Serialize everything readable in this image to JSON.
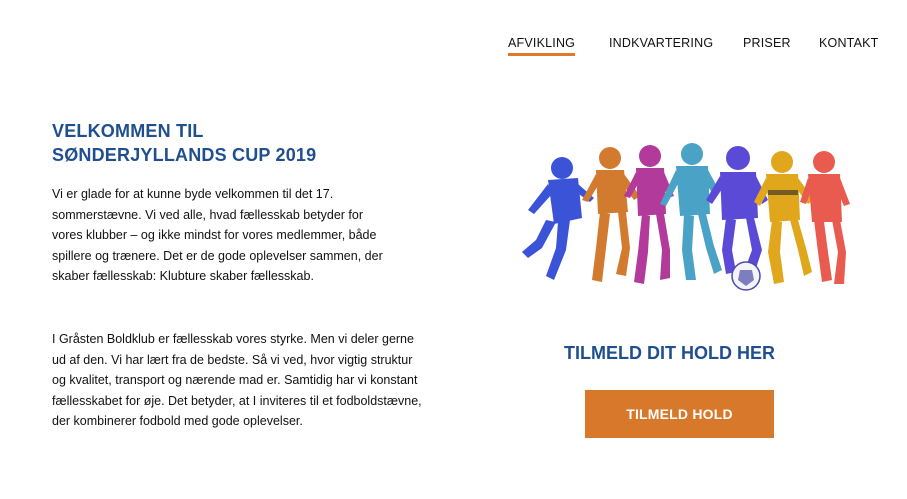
{
  "nav": {
    "items": [
      {
        "label": "AFVIKLING",
        "active": true
      },
      {
        "label": "INDKVARTERING",
        "active": false
      },
      {
        "label": "PRISER",
        "active": false
      },
      {
        "label": "KONTAKT",
        "active": false
      }
    ],
    "accent_color": "#e07a2a"
  },
  "main": {
    "title_line1": "VELKOMMEN TIL",
    "title_line2": "SØNDERJYLLANDS CUP 2019",
    "paragraph1": "Vi er glade for at kunne byde velkommen til det 17. sommerstævne. Vi ved alle, hvad fællesskab betyder for vores klubber – og ikke mindst for vores medlemmer, både spillere og trænere. Det er de gode oplevelser sammen, der skaber fællesskab: Klubture skaber fællesskab.",
    "paragraph2": "I Gråsten Boldklub er fællesskab vores styrke. Men vi deler gerne ud af den. Vi har lært fra de bedste. Så vi ved, hvor vigtig struktur og kvalitet, transport og nærende mad er. Samtidig har vi konstant fællesskabet for øje. Det betyder, at I inviteres til et fodboldstævne, der kombinerer fodbold med gode oplevelser."
  },
  "hero": {
    "image": "children-playing-football-illustration",
    "player_colors": [
      "#3b53d6",
      "#d27a2e",
      "#b23a9b",
      "#4aa3c7",
      "#5b4ad6",
      "#e0a71d",
      "#e95b4f"
    ]
  },
  "cta": {
    "title": "TILMELD DIT HOLD HER",
    "button_label": "TILMELD HOLD",
    "button_color": "#d8782b",
    "title_color": "#1f4f8f"
  }
}
